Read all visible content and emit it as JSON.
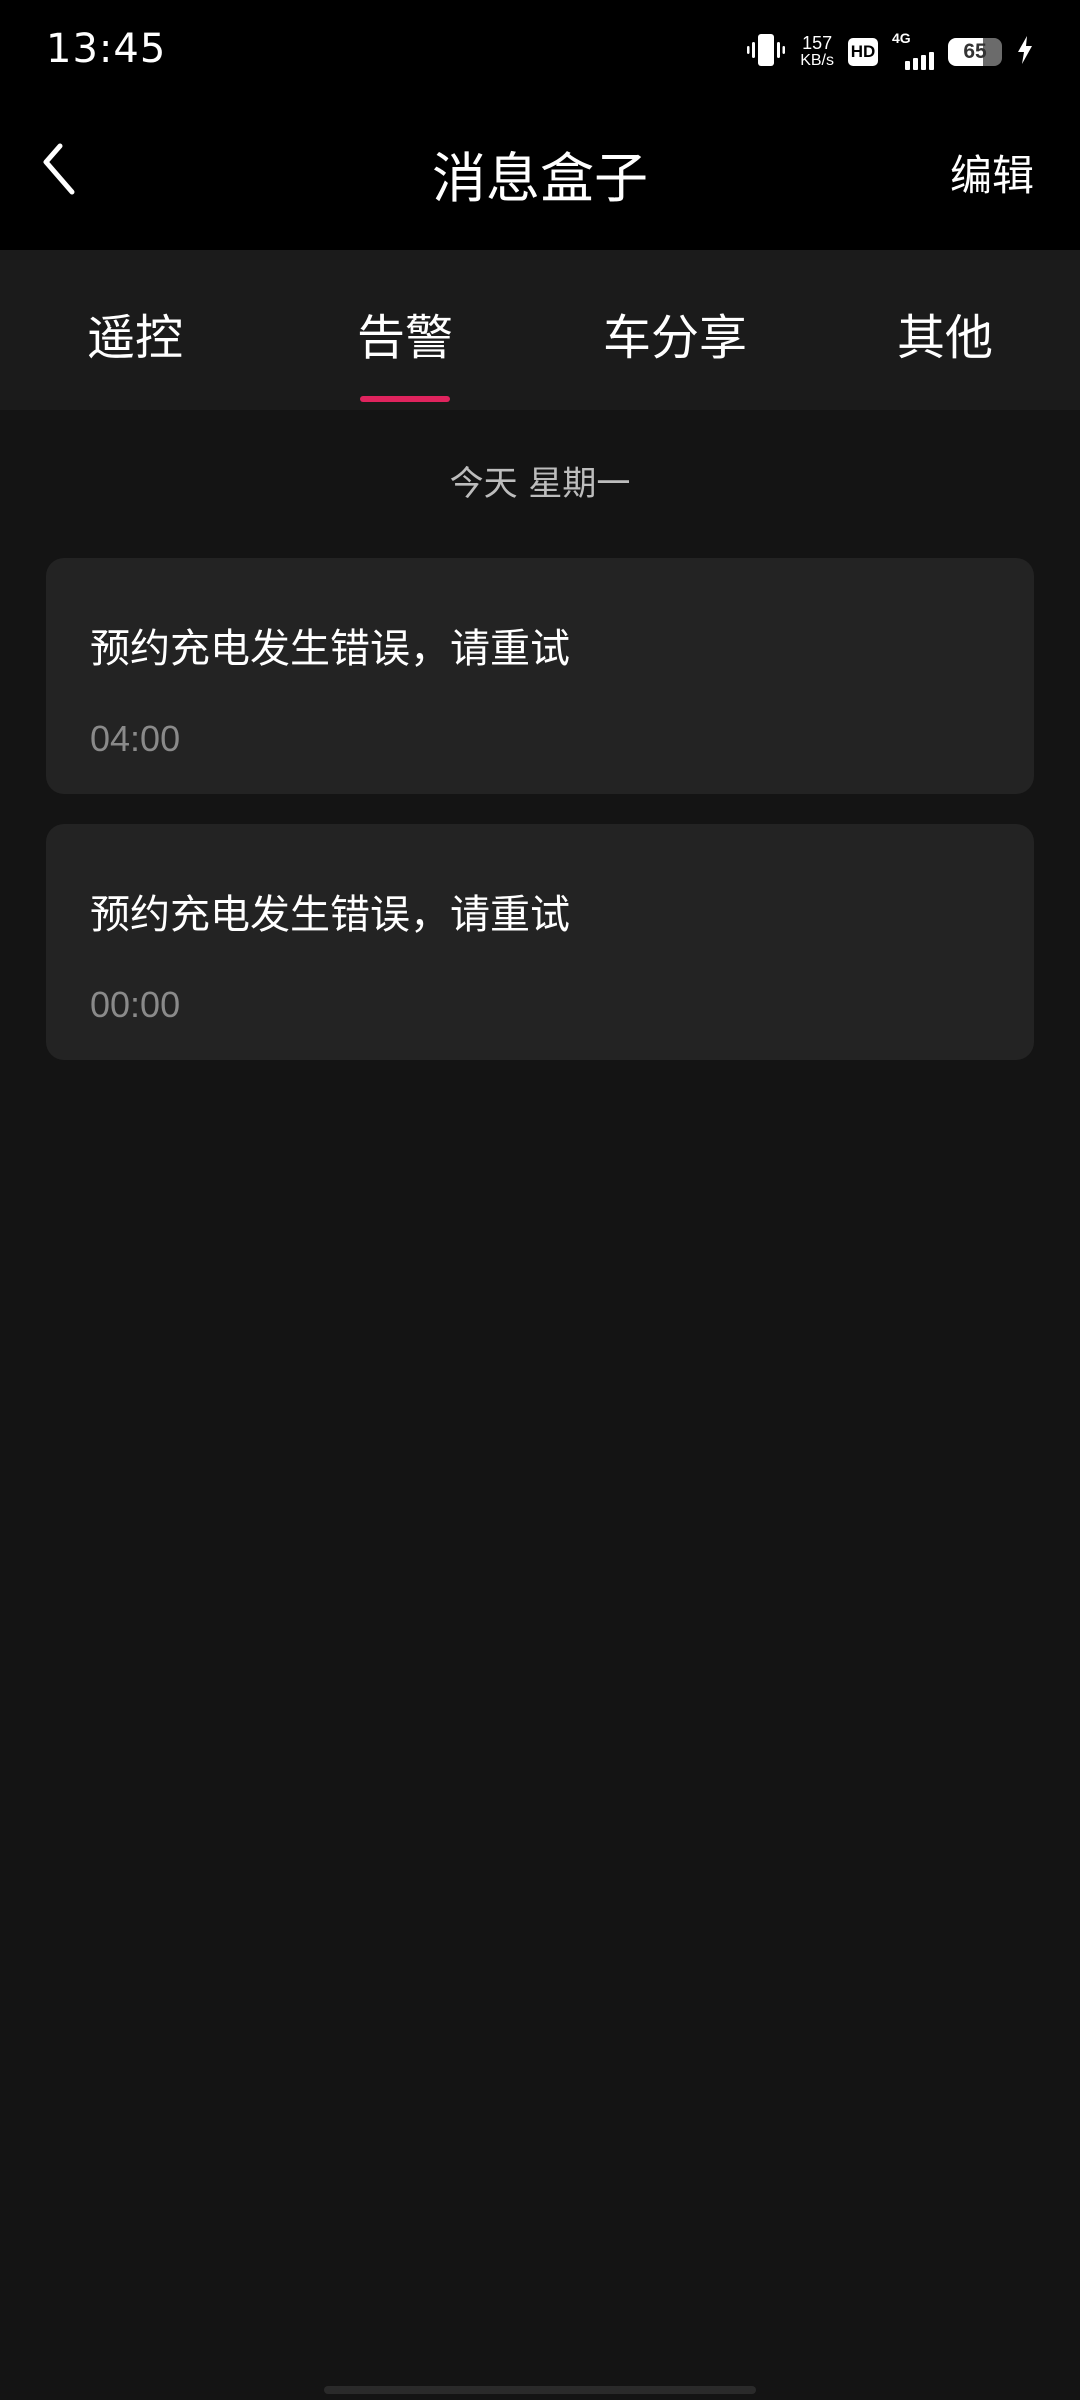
{
  "status_bar": {
    "time": "13:45",
    "net_speed_value": "157",
    "net_speed_unit": "KB/s",
    "hd": "HD",
    "network": "4G",
    "battery": "65",
    "battery_level_percent": 65
  },
  "header": {
    "title": "消息盒子",
    "edit_label": "编辑"
  },
  "tabs": [
    {
      "label": "遥控",
      "active": false
    },
    {
      "label": "告警",
      "active": true
    },
    {
      "label": "车分享",
      "active": false
    },
    {
      "label": "其他",
      "active": false
    }
  ],
  "accent_color": "#e0245e",
  "date_header": "今天 星期一",
  "messages": [
    {
      "title": "预约充电发生错误，请重试",
      "time": "04:00"
    },
    {
      "title": "预约充电发生错误，请重试",
      "time": "00:00"
    }
  ]
}
